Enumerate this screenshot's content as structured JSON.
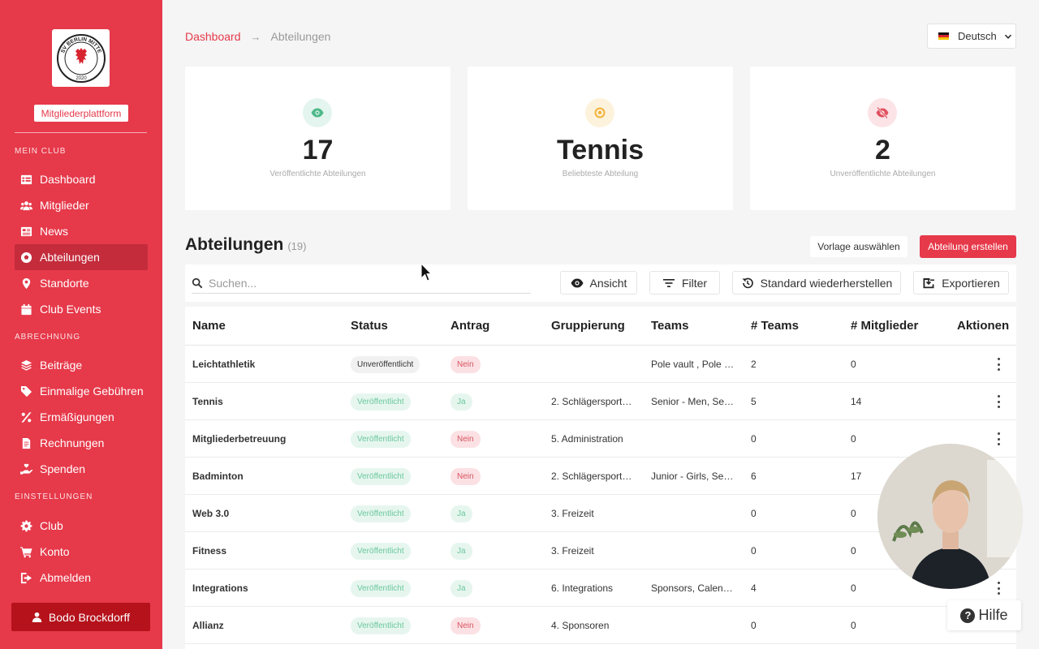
{
  "colors": {
    "brand": "#e6394a",
    "brand_dark": "#b5121b",
    "published": "#6ac79b",
    "nein": "#d9535f"
  },
  "logo": {
    "text_top": "SV BERLIN MITTE",
    "year": "2020"
  },
  "sidebar": {
    "platform_badge": "Mitgliederplattform",
    "sections": {
      "club": "MEIN CLUB",
      "billing": "ABRECHNUNG",
      "settings": "EINSTELLUNGEN"
    },
    "items": [
      {
        "label": "Dashboard",
        "icon": "table-icon"
      },
      {
        "label": "Mitglieder",
        "icon": "users-icon"
      },
      {
        "label": "News",
        "icon": "newspaper-icon"
      },
      {
        "label": "Abteilungen",
        "icon": "football-icon",
        "active": true
      },
      {
        "label": "Standorte",
        "icon": "map-pin-icon"
      },
      {
        "label": "Club Events",
        "icon": "calendar-icon"
      },
      {
        "label": "Beiträge",
        "icon": "layers-icon"
      },
      {
        "label": "Einmalige Gebühren",
        "icon": "tag-icon"
      },
      {
        "label": "Ermäßigungen",
        "icon": "percent-icon"
      },
      {
        "label": "Rechnungen",
        "icon": "invoice-icon"
      },
      {
        "label": "Spenden",
        "icon": "donate-icon"
      },
      {
        "label": "Club",
        "icon": "gear-icon"
      },
      {
        "label": "Konto",
        "icon": "cart-icon"
      },
      {
        "label": "Abmelden",
        "icon": "logout-icon"
      }
    ],
    "user_name": "Bodo Brockdorff"
  },
  "breadcrumb": {
    "home": "Dashboard",
    "current": "Abteilungen"
  },
  "language": "Deutsch",
  "stats": [
    {
      "value": "17",
      "label": "Veröffentlichte Abteilungen",
      "icon": "eye-icon"
    },
    {
      "value": "Tennis",
      "label": "Beliebteste Abteilung",
      "icon": "football-icon"
    },
    {
      "value": "2",
      "label": "Unveröffentlichte Abteilungen",
      "icon": "eye-slash-icon"
    }
  ],
  "section": {
    "title": "Abteilungen",
    "count": "(19)"
  },
  "actions": {
    "template": "Vorlage auswählen",
    "create": "Abteilung erstellen"
  },
  "toolbar": {
    "search_placeholder": "Suchen...",
    "view": "Ansicht",
    "filter": "Filter",
    "reset": "Standard wiederherstellen",
    "export": "Exportieren"
  },
  "table": {
    "headers": [
      "Name",
      "Status",
      "Antrag",
      "Gruppierung",
      "Teams",
      "# Teams",
      "# Mitglieder",
      "Aktionen"
    ],
    "rows": [
      {
        "name": "Leichtathletik",
        "status": "Unveröffentlicht",
        "antrag": "Nein",
        "gruppierung": "",
        "teams": "Pole vault , Pole vault",
        "num_teams": "2",
        "num_members": "0"
      },
      {
        "name": "Tennis",
        "status": "Veröffentlicht",
        "antrag": "Ja",
        "gruppierung": "2. Schlägersportarten",
        "teams": "Senior - Men, Senior - Women",
        "num_teams": "5",
        "num_members": "14"
      },
      {
        "name": "Mitgliederbetreuung",
        "status": "Veröffentlicht",
        "antrag": "Nein",
        "gruppierung": "5. Administration",
        "teams": "",
        "num_teams": "0",
        "num_members": "0"
      },
      {
        "name": "Badminton",
        "status": "Veröffentlicht",
        "antrag": "Nein",
        "gruppierung": "2. Schlägersportarten",
        "teams": "Junior - Girls, Senior",
        "num_teams": "6",
        "num_members": "17"
      },
      {
        "name": "Web 3.0",
        "status": "Veröffentlicht",
        "antrag": "Ja",
        "gruppierung": "3. Freizeit",
        "teams": "",
        "num_teams": "0",
        "num_members": "0"
      },
      {
        "name": "Fitness",
        "status": "Veröffentlicht",
        "antrag": "Ja",
        "gruppierung": "3. Freizeit",
        "teams": "",
        "num_teams": "0",
        "num_members": "0"
      },
      {
        "name": "Integrations",
        "status": "Veröffentlicht",
        "antrag": "Ja",
        "gruppierung": "6. Integrations",
        "teams": "Sponsors, Calendars",
        "num_teams": "4",
        "num_members": "0"
      },
      {
        "name": "Allianz",
        "status": "Veröffentlicht",
        "antrag": "Nein",
        "gruppierung": "4. Sponsoren",
        "teams": "",
        "num_teams": "0",
        "num_members": "0"
      }
    ]
  },
  "help": "Hilfe"
}
